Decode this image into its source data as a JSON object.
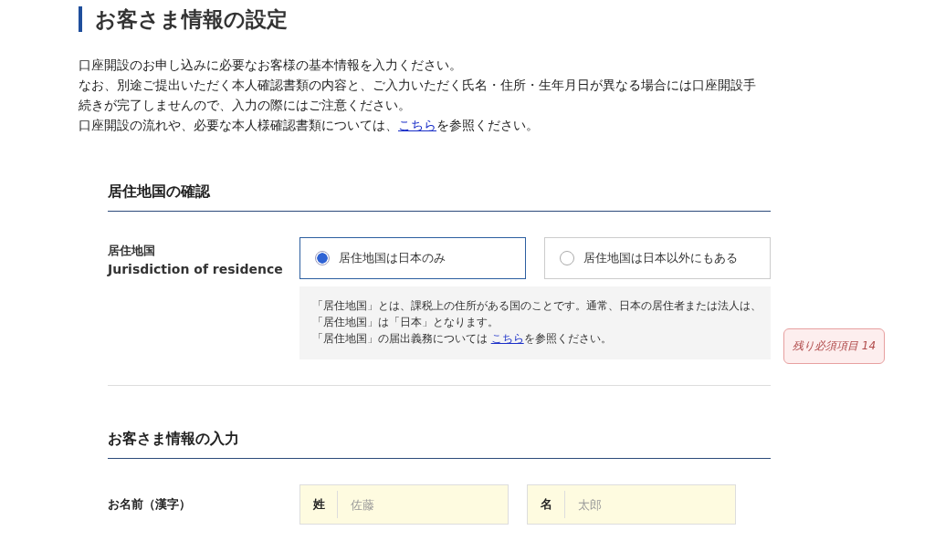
{
  "page_title": "お客さま情報の設定",
  "intro": [
    {
      "text": "口座開設のお申し込みに必要なお客様の基本情報を入力ください。"
    },
    {
      "text": "なお、別途ご提出いただく本人確認書類の内容と、ご入力いただく氏名・住所・生年月日が異なる場合には口座開設手"
    },
    {
      "text": "続きが完了しませんので、入力の際にはご注意ください。"
    },
    {
      "text": "口座開設の流れや、必要な本人様確認書類については、",
      "link": "こちら",
      "after": "を参照ください。"
    }
  ],
  "residence_section": {
    "title": "居住地国の確認",
    "label": "居住地国",
    "label_en": "Jurisdiction of residence",
    "options": [
      {
        "label": "居住地国は日本のみ",
        "selected": true
      },
      {
        "label": "居住地国は日本以外にもある",
        "selected": false
      }
    ],
    "note": [
      {
        "text": "「居住地国」とは、課税上の住所がある国のことです。通常、日本の居住者または法人は、"
      },
      {
        "text": "「居住地国」は「日本」となります。"
      },
      {
        "text": "「居住地国」の届出義務については ",
        "link": "こちら",
        "after": "を参照ください。"
      }
    ]
  },
  "remaining_badge": "残り必須項目 14",
  "customer_section": {
    "title": "お客さま情報の入力",
    "label": "お名前（漢字）",
    "fields": [
      {
        "prefix": "姓",
        "placeholder": "佐藤"
      },
      {
        "prefix": "名",
        "placeholder": "太郎"
      }
    ]
  }
}
